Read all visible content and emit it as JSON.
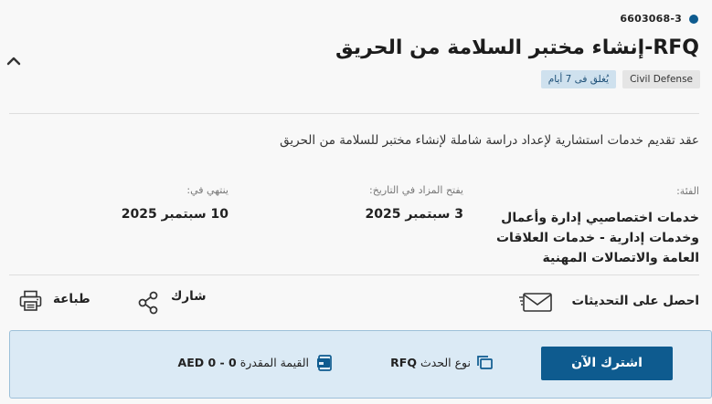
{
  "tender": {
    "ref_number": "6603068-3",
    "title": "RFQ-إنشاء مختبر السلامة من الحريق",
    "badges": {
      "organization": "Civil Defense",
      "closing": "يُغلق فى 7 أيام"
    },
    "description": "عقد تقديم خدمات استشارية لإعداد دراسة شاملة لإنشاء مختبر للسلامة من الحريق"
  },
  "details": {
    "category_label": "الفئة:",
    "category_value": "خدمات اختصاصيي إدارة وأعمال وخدمات إدارية - خدمات العلاقات العامة والاتصالات المهنية",
    "open_date_label": "يفتح المزاد في التاريخ:",
    "open_date_value": "3 سبتمبر 2025",
    "end_date_label": "ينتهي في:",
    "end_date_value": "10 سبتمبر 2025"
  },
  "actions": {
    "get_updates": "احصل على التحديثات",
    "share": "شارك",
    "print": "طباعة"
  },
  "panel": {
    "subscribe_button": "اشترك الآن",
    "event_type_label": "نوع الحدث",
    "event_type_value": "RFQ",
    "estimated_value_label": "القيمة المقدرة",
    "estimated_value_value": "AED 0 - 0"
  },
  "colors": {
    "primary": "#0e5b8f",
    "panel_bg": "#dbeaf5",
    "panel_border": "#9cc0d9",
    "closing_badge_bg": "#cfe1ee",
    "org_badge_bg": "#e5e5e5"
  },
  "icons": {
    "collapse": "chevron-up-icon",
    "updates": "envelope-icon",
    "share": "share-icon",
    "print": "printer-icon",
    "event_type": "copy-documents-icon",
    "estimated_value": "card-icon"
  }
}
